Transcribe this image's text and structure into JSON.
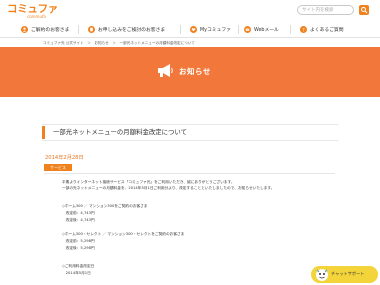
{
  "header": {
    "logo_text": "コミュファ",
    "logo_sub": "commufa",
    "search_placeholder": "サイト内を検索"
  },
  "nav": {
    "items": [
      {
        "label": "ご解約のお客さま",
        "icon": "person-icon"
      },
      {
        "label": "お申し込みをご検討のお客さま",
        "icon": "document-icon"
      },
      {
        "label": "Myコミュファ",
        "icon": "heart-icon"
      },
      {
        "label": "Webメール",
        "icon": "mail-icon"
      },
      {
        "label": "よくあるご質問",
        "icon": "question-icon"
      }
    ]
  },
  "breadcrumb": "コミュファ光 公式サイト　＞　お知らせ　＞　一部光ネットメニューの月額料金改定について",
  "banner": {
    "title": "お知らせ",
    "icon": "megaphone-icon",
    "color": "#f1783a"
  },
  "article": {
    "heading": "一部光ネットメニューの月額料金改定について",
    "date": "2014年2月28日",
    "tag": "サービス",
    "lines": [
      "平素よりインターネット接続サービス「コミュファ光」をご利用いただき、誠にありがとうございます。",
      "一部の光ネットメニューの月額料金を、2014年5月1日ご利用分より、改定することといたしましたので、お知らせいたします。",
      "",
      "◇ホーム300 ／ マンション300をご契約のお客さま",
      "　改定前：4,743円",
      "　改定後：4,743円",
      "",
      "◇ホーム300・セレクト ／ マンション300・セレクトをご契約のお客さま",
      "　改定前：5,298円",
      "　改定後：5,298円",
      "",
      "◇ご利用料金改定日",
      "　2014年5月1日"
    ]
  },
  "support": {
    "label": "チャットサポート",
    "icon": "mascot-icon"
  }
}
